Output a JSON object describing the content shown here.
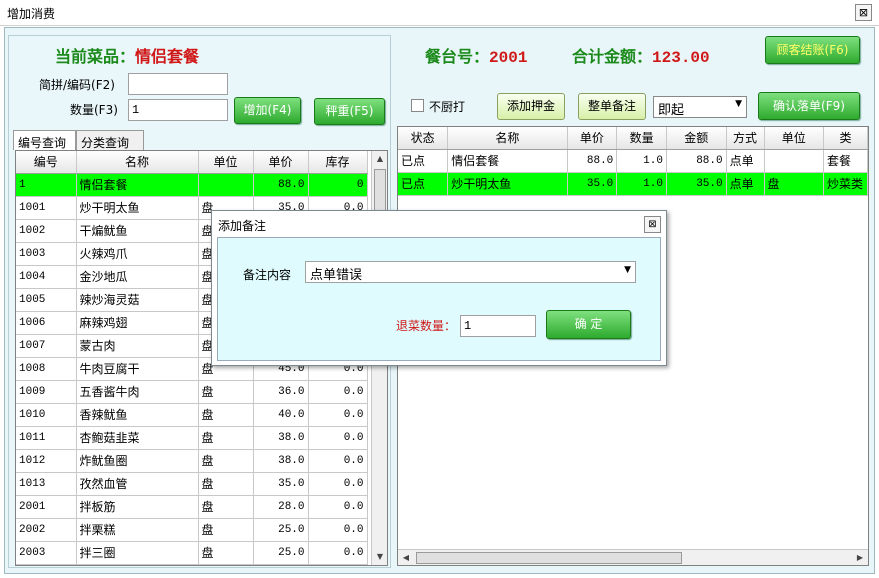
{
  "window": {
    "title": "增加消费",
    "close_glyph": "⊠"
  },
  "left": {
    "current_dish_label": "当前菜品：",
    "current_dish_value": "情侣套餐",
    "code_label": "简拼/编码(F2)",
    "code_value": "",
    "qty_label": "数量(F3)",
    "qty_value": "1",
    "add_button": "增加(F4)",
    "weigh_button": "秤重(F5)",
    "tabs": [
      "编号查询",
      "分类查询"
    ],
    "columns": [
      "编号",
      "名称",
      "单位",
      "单价",
      "库存"
    ],
    "rows": [
      [
        "1",
        "情侣套餐",
        "",
        "88.0",
        "0"
      ],
      [
        "1001",
        "炒干明太鱼",
        "盘",
        "35.0",
        "0.0"
      ],
      [
        "1002",
        "干煸鱿鱼",
        "盘",
        "",
        ""
      ],
      [
        "1003",
        "火辣鸡爪",
        "盘",
        "",
        ""
      ],
      [
        "1004",
        "金沙地瓜",
        "盘",
        "",
        ""
      ],
      [
        "1005",
        "辣炒海灵菇",
        "盘",
        "",
        ""
      ],
      [
        "1006",
        "麻辣鸡翅",
        "盘",
        "",
        ""
      ],
      [
        "1007",
        "蒙古肉",
        "盘",
        "",
        ""
      ],
      [
        "1008",
        "牛肉豆腐干",
        "盘",
        "45.0",
        "0.0"
      ],
      [
        "1009",
        "五香酱牛肉",
        "盘",
        "36.0",
        "0.0"
      ],
      [
        "1010",
        "香辣鱿鱼",
        "盘",
        "40.0",
        "0.0"
      ],
      [
        "1011",
        "杏鲍菇韭菜",
        "盘",
        "38.0",
        "0.0"
      ],
      [
        "1012",
        "炸鱿鱼圈",
        "盘",
        "38.0",
        "0.0"
      ],
      [
        "1013",
        "孜然血管",
        "盘",
        "35.0",
        "0.0"
      ],
      [
        "2001",
        "拌板筋",
        "盘",
        "28.0",
        "0.0"
      ],
      [
        "2002",
        "拌栗糕",
        "盘",
        "25.0",
        "0.0"
      ],
      [
        "2003",
        "拌三圈",
        "盘",
        "25.0",
        "0.0"
      ]
    ]
  },
  "right": {
    "table_label": "餐台号：",
    "table_value": "2001",
    "total_label": "合计金额：",
    "total_value": "123.00",
    "checkout_button": "顾客结账(F6)",
    "no_kitchen_print_label": "不厨打",
    "add_deposit_button": "添加押金",
    "order_note_button": "整单备注",
    "serve_select": "即起",
    "confirm_button": "确认落单(F9)",
    "columns": [
      "状态",
      "名称",
      "单价",
      "数量",
      "金额",
      "方式",
      "单位",
      "类"
    ],
    "rows": [
      [
        "已点",
        "情侣套餐",
        "88.0",
        "1.0",
        "88.0",
        "点单",
        "",
        "套餐"
      ],
      [
        "已点",
        "炒干明太鱼",
        "35.0",
        "1.0",
        "35.0",
        "点单",
        "盘",
        "炒菜类"
      ]
    ]
  },
  "dialog": {
    "title": "添加备注",
    "note_label": "备注内容",
    "note_value": "点单错误",
    "return_qty_label": "退菜数量：",
    "return_qty_value": "1",
    "ok_button": "确 定"
  },
  "colors": {
    "selected_row": "#00ff00",
    "label_green": "#1b8a1b",
    "value_red": "#d01818",
    "panel_bg": "#e8f6f9"
  }
}
